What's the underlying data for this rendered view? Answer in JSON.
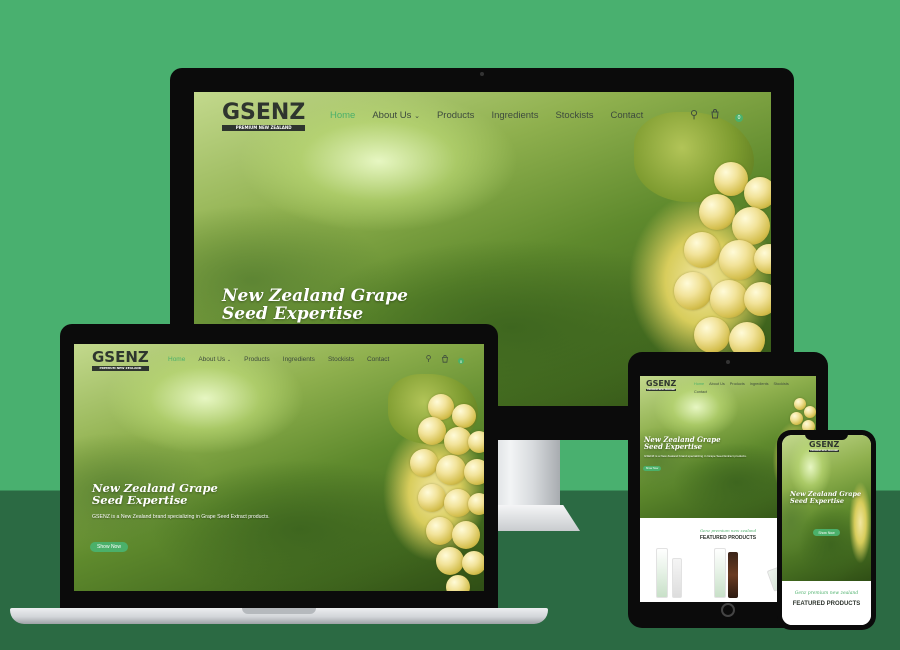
{
  "brand": {
    "name": "GSENZ",
    "tagline": "PREMIUM NEW ZEALAND"
  },
  "nav": {
    "items": [
      {
        "label": "Home",
        "active": true
      },
      {
        "label": "About Us",
        "dropdown": true
      },
      {
        "label": "Products"
      },
      {
        "label": "Ingredients"
      },
      {
        "label": "Stockists"
      },
      {
        "label": "Contact"
      }
    ],
    "cart_count": "0",
    "icons": [
      "search-icon",
      "cart-icon"
    ]
  },
  "hero": {
    "title_line1": "New Zealand Grape",
    "title_line2": "Seed Expertise",
    "description": "GSENZ is a New Zealand brand specializing in Grape Seed Extract products.",
    "button_label": "Show Now"
  },
  "featured": {
    "tagline": "Genz premium new zealand",
    "heading": "FEATURED PRODUCTS"
  },
  "colors": {
    "accent": "#4bb06a",
    "background_top": "#49b06f",
    "background_bottom": "#2b6a43",
    "text_dark": "#2e352e"
  }
}
